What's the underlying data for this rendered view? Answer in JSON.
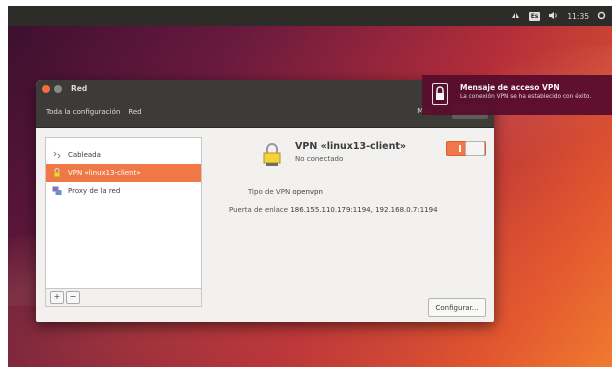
{
  "topbar": {
    "keyboard_indicator": "Es",
    "clock": "11:35",
    "icons": [
      "network-icon",
      "keyboard-icon",
      "volume-icon",
      "gear-icon"
    ]
  },
  "window": {
    "title": "Red",
    "breadcrumb_all": "Toda la configuración",
    "breadcrumb_current": "Red",
    "mode_label": "Mod"
  },
  "sidebar": {
    "items": [
      {
        "label": "Cableada",
        "icon": "ethernet-icon"
      },
      {
        "label": "VPN «linux13-client»",
        "icon": "vpn-lock-icon"
      },
      {
        "label": "Proxy de la red",
        "icon": "proxy-icon"
      }
    ],
    "add_label": "+",
    "remove_label": "−"
  },
  "detail": {
    "name": "VPN «linux13-client»",
    "status": "No conectado",
    "vpn_type_label": "Tipo de VPN",
    "vpn_type_value": "openvpn",
    "gateway_label": "Puerta de enlace",
    "gateway_value": "186.155.110.179:1194, 192.168.0.7:1194",
    "configure_button": "Configurar..."
  },
  "notification": {
    "title": "Mensaje de acceso VPN",
    "body": "La conexión VPN se ha establecido con éxito."
  },
  "colors": {
    "accent": "#f07746",
    "titlebar": "#3c3b37",
    "notification_bg": "#5a0d2d"
  }
}
